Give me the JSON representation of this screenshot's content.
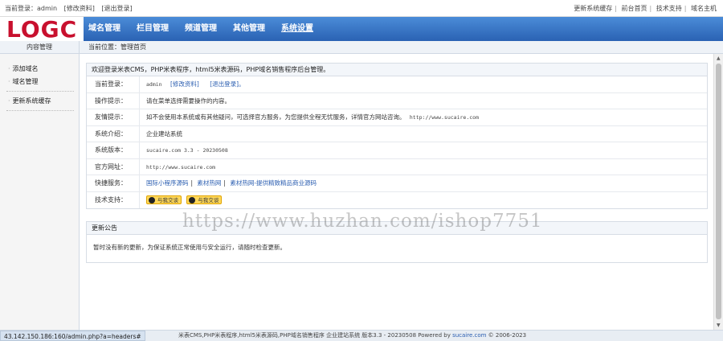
{
  "topbar": {
    "current_login": "当前登录：admin",
    "edit_profile": "[修改资料]",
    "logout": "[退出登录]",
    "links": [
      "更新系统缓存",
      "前台首页",
      "技术支持",
      "域名主机"
    ]
  },
  "logo": {
    "text": "LOGC",
    "color": "#c8102e"
  },
  "nav": {
    "items": [
      "域名管理",
      "栏目管理",
      "频道管理",
      "其他管理",
      "系统设置"
    ],
    "active_index": 4
  },
  "subbar": {
    "side_title": "内容管理",
    "breadcrumb": "当前位置：管理首页"
  },
  "sidebar": {
    "group1": [
      "添加域名",
      "域名管理"
    ],
    "group2": [
      "更新系统缓存"
    ]
  },
  "welcome": {
    "title": "欢迎登录米表CMS，PHP米表程序，html5米表源码，PHP域名销售程序后台管理。",
    "rows": {
      "current_login": {
        "label": "当前登录：",
        "user": "admin",
        "edit": "[修改资料]",
        "logout": "[退出登录]。"
      },
      "tip": {
        "label": "操作提示：",
        "value": "请在菜单选择需要操作的内容。"
      },
      "friendly": {
        "label": "友情提示：",
        "value": "如不会使用本系统或有其他疑问，可选择官方服务，为您提供全程无忧服务，详情官方网站咨询。",
        "url": "http://www.sucaire.com"
      },
      "intro": {
        "label": "系统介绍：",
        "value": "企业建站系统"
      },
      "version": {
        "label": "系统版本：",
        "value": "sucaire.com 3.3 - 20230508"
      },
      "website": {
        "label": "官方网址：",
        "value": "http://www.sucaire.com"
      },
      "quick": {
        "label": "快捷服务：",
        "links": [
          "国际小程序源码",
          "素材热网",
          "素材热网-提供精致精品商业源码"
        ]
      },
      "support": {
        "label": "技术支持：",
        "buttons": [
          "与我交谈",
          "与我交谈"
        ]
      }
    }
  },
  "notice": {
    "title": "更新公告",
    "body": "暂时没有新的更新，为保证系统正常使用与安全运行，请随时检查更新。"
  },
  "watermark": "https://www.huzhan.com/ishop7751",
  "footer": {
    "url": "43.142.150.186:160/admin.php?a=headers#",
    "copy": "米表CMS,PHP米表程序,html5米表源码,PHP域名销售程序  企业建站系统 版本3.3 - 20230508 Powered by ",
    "brand": "sucaire.com",
    "year": " © 2006-2023"
  }
}
